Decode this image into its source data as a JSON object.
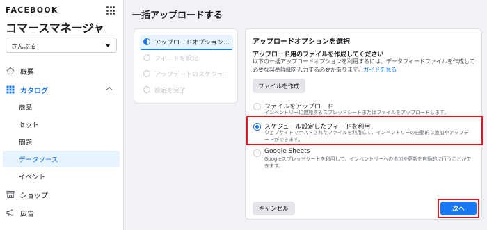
{
  "sidebar": {
    "brand": "FACEBOOK",
    "app_title": "コマースマネージャ",
    "account_select": "さんぷる",
    "nav": {
      "overview": "概要",
      "catalog": "カタログ",
      "catalog_items": [
        "商品",
        "セット",
        "問題",
        "データソース",
        "イベント"
      ],
      "shop": "ショップ",
      "ads": "広告"
    }
  },
  "main": {
    "page_title": "一括アップロードする",
    "steps": [
      "アップロードオプション...",
      "フィードを設定",
      "アップデートのスケジュ...",
      "設定を完了"
    ],
    "card": {
      "title": "アップロードオプションを選択",
      "subtitle": "アップロード用のファイルを作成してください",
      "description": "以下の一括アップロードオプションを利用するには、データフィードファイルを作成して必要な製品詳細を入力する必要があります。",
      "guide_link": "ガイドを見る",
      "create_file_button": "ファイルを作成",
      "options": [
        {
          "title": "ファイルをアップロード",
          "desc": "インベントリーに追加するスプレッドシートまたはファイルをアップロードします。"
        },
        {
          "title": "スケジュール設定したフィードを利用",
          "desc": "ウェブサイトでホストされたファイルを利用して、インベントリーの自動的な追加やアップデートができます。"
        },
        {
          "title": "Google Sheets",
          "desc": "Googleスプレッドシートを利用して、インベントリーへの追加や更新を自動的に行うことができます。"
        }
      ],
      "cancel_button": "キャンセル",
      "next_button": "次へ"
    }
  },
  "colors": {
    "accent": "#1877f2",
    "highlight": "#e0161f"
  }
}
